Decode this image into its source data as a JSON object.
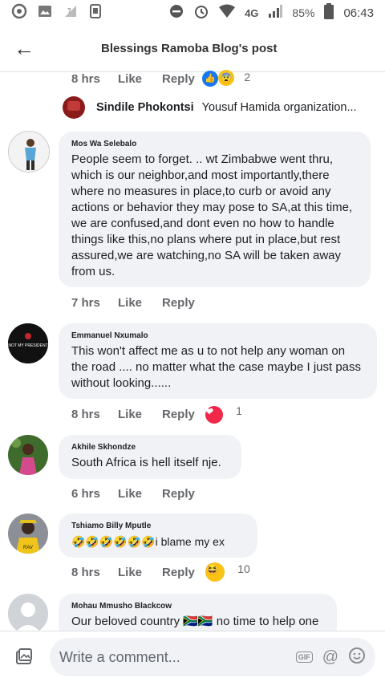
{
  "status": {
    "network": "4G",
    "battery": "85%",
    "time": "06:43"
  },
  "header": {
    "title": "Blessings Ramoba Blog's post"
  },
  "prev_meta": {
    "time": "8 hrs",
    "like": "Like",
    "reply": "Reply",
    "count": "2"
  },
  "reply_preview": {
    "name": "Sindile Phokontsi",
    "text": "Yousuf Hamida organization..."
  },
  "comments": [
    {
      "name": "Mos Wa Selebalo",
      "text": "People seem to forget. .. wt Zimbabwe went thru, which is our neighbor,and most importantly,there where no measures in place,to curb or avoid any actions or behavior they may pose to SA,at this time, we are confused,and dont even no how to handle things like this,no plans where put in place,but rest assured,we are watching,no SA will be taken away from us.",
      "time": "7 hrs",
      "like": "Like",
      "reply": "Reply",
      "count": ""
    },
    {
      "name": "Emmanuel Nxumalo",
      "avatar_text": "NOT MY PRESIDENT",
      "text": "This won't affect me  as u to not help any woman on the road .... no matter what the case maybe I just pass without looking......",
      "time": "8 hrs",
      "like": "Like",
      "reply": "Reply",
      "count": "1"
    },
    {
      "name": "Akhile Skhondze",
      "text": "South Africa is hell itself nje.",
      "time": "6 hrs",
      "like": "Like",
      "reply": "Reply",
      "count": ""
    },
    {
      "name": "Tshiamo Billy Mputle",
      "text": "🤣🤣🤣🤣🤣🤣i blame my ex",
      "time": "8 hrs",
      "like": "Like",
      "reply": "Reply",
      "count": "10"
    },
    {
      "name": "Mohau Mmusho Blackcow",
      "text": "Our beloved country 🇿🇦🇿🇦 no time to help one"
    }
  ],
  "compose": {
    "placeholder": "Write a comment...",
    "gif_label": "GIF"
  }
}
